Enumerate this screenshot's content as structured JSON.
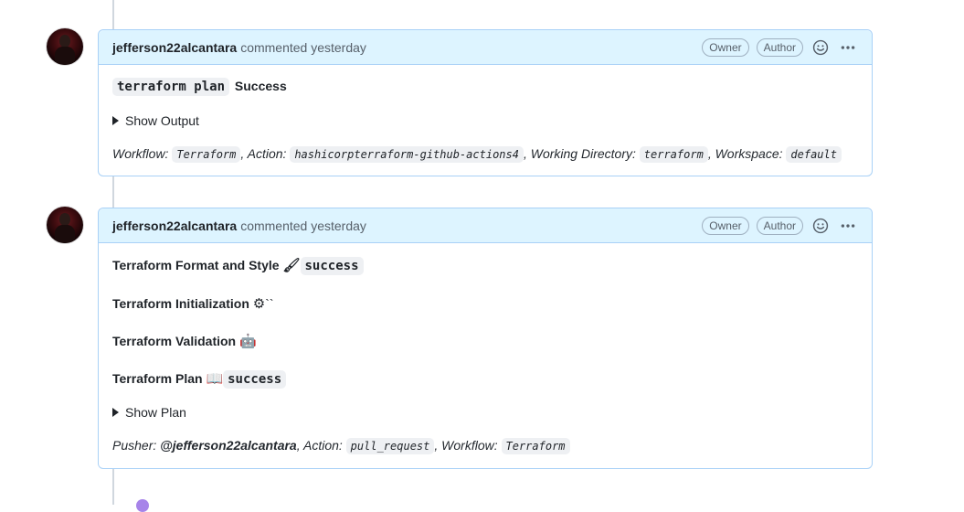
{
  "comments": [
    {
      "author": "jefferson22alcantara",
      "action_text": "commented yesterday",
      "badges": [
        "Owner",
        "Author"
      ],
      "body": {
        "plan_cmd": "terraform plan",
        "plan_status": "Success",
        "details_summary": "Show Output",
        "footer": {
          "workflow_label": "Workflow:",
          "workflow_value": "Terraform",
          "action_label": ", Action:",
          "action_value": "hashicorpterraform-github-actions4",
          "dir_label": ", Working Directory:",
          "dir_value": "terraform",
          "workspace_label": ", Workspace:",
          "workspace_value": "default"
        }
      }
    },
    {
      "author": "jefferson22alcantara",
      "action_text": "commented yesterday",
      "badges": [
        "Owner",
        "Author"
      ],
      "body": {
        "fmt_label": "Terraform Format and Style",
        "fmt_emoji": "🖌",
        "fmt_status": "success",
        "init_label": "Terraform Initialization",
        "init_emoji": "⚙",
        "init_trail": "``",
        "validate_label": "Terraform Validation",
        "validate_emoji": "🤖",
        "plan_label": "Terraform Plan",
        "plan_emoji": "📖",
        "plan_status": "success",
        "details_summary": "Show Plan",
        "footer": {
          "pusher_label": "Pusher:",
          "pusher_value": "@jefferson22alcantara",
          "action_label": ", Action:",
          "action_value": "pull_request",
          "workflow_label": ", Workflow:",
          "workflow_value": "Terraform"
        }
      }
    }
  ],
  "icons": {
    "reaction": "smiley-icon",
    "more": "kebab-horizontal-icon"
  }
}
